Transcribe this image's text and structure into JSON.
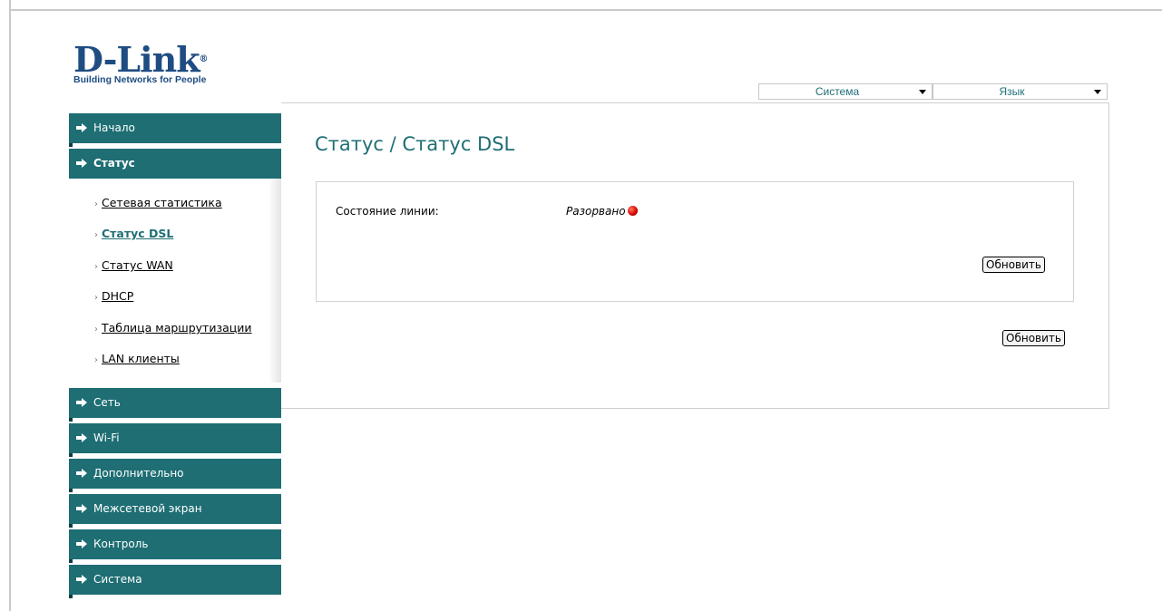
{
  "logo": {
    "brand": "D-Link",
    "registered": "®",
    "tagline": "Building Networks for People"
  },
  "top_menu": {
    "system": "Система",
    "language": "Язык"
  },
  "sidebar": {
    "items": [
      {
        "label": "Начало"
      },
      {
        "label": "Статус"
      },
      {
        "label": "Сеть"
      },
      {
        "label": "Wi-Fi"
      },
      {
        "label": "Дополнительно"
      },
      {
        "label": "Межсетевой экран"
      },
      {
        "label": "Контроль"
      },
      {
        "label": "Система"
      }
    ],
    "status_submenu": [
      {
        "label": "Сетевая статистика"
      },
      {
        "label": "Статус DSL"
      },
      {
        "label": "Статус WAN"
      },
      {
        "label": "DHCP"
      },
      {
        "label": "Таблица маршрутизации"
      },
      {
        "label": "LAN клиенты"
      }
    ]
  },
  "main": {
    "title": "Статус / Статус DSL",
    "line_state_label": "Состояние линии:",
    "line_state_value": "Разорвано",
    "refresh_inner": "Обновить",
    "refresh_outer": "Обновить"
  },
  "colors": {
    "accent": "#1e6e74",
    "brand": "#1f4c82",
    "status_error": "#d10000"
  }
}
